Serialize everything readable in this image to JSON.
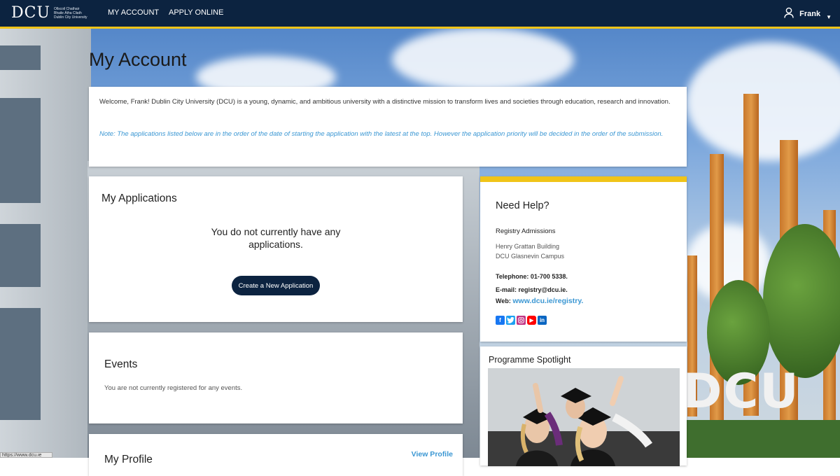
{
  "header": {
    "logo_text": "DCU",
    "logo_sub_1": "Ollscoil Chathair",
    "logo_sub_2": "Bhaile Átha Cliath",
    "logo_sub_3": "Dublin City University",
    "nav": [
      {
        "label": "MY ACCOUNT"
      },
      {
        "label": "APPLY ONLINE"
      }
    ],
    "user_name": "Frank",
    "accent_color": "#f0c419",
    "bar_color": "#0c2340"
  },
  "page": {
    "title": "My Account"
  },
  "welcome": {
    "intro": "Welcome, Frank! Dublin City University (DCU) is a young, dynamic, and ambitious university with a distinctive mission to transform lives and societies through education, research and innovation.",
    "note": "Note: The applications listed below are in the order of the date of starting the application with the latest at the top. However the application priority will be decided in the order of the submission."
  },
  "applications": {
    "title": "My Applications",
    "empty_message": "You do not currently have any applications.",
    "create_button": "Create a New Application"
  },
  "events": {
    "title": "Events",
    "empty_message": "You are not currently registered for any events."
  },
  "profile": {
    "title": "My Profile",
    "view_link": "View Profile"
  },
  "help": {
    "title": "Need Help?",
    "office": "Registry Admissions",
    "address_1": "Henry Grattan Building",
    "address_2": "DCU Glasnevin Campus",
    "telephone": "Telephone: 01-700 5338.",
    "email": "E-mail: registry@dcu.ie.",
    "web_label": "Web:",
    "web_link": "www.dcu.ie/registry.",
    "social_icons": [
      "facebook-icon",
      "twitter-icon",
      "instagram-icon",
      "youtube-icon",
      "linkedin-icon"
    ]
  },
  "spotlight": {
    "title": "Programme Spotlight"
  },
  "status_bar": {
    "text": "https://www.dcu.ie"
  },
  "background_sign": "DCU"
}
